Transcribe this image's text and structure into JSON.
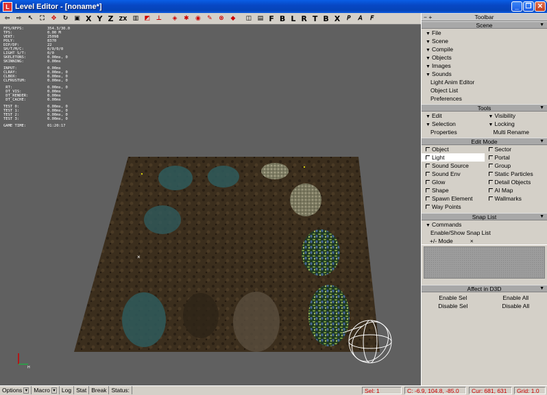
{
  "window": {
    "title": "Level Editor - [noname*]",
    "app_icon": "L"
  },
  "toolbar": {
    "axis_labels": [
      "X",
      "Y",
      "Z",
      "ZX"
    ],
    "view_labels": [
      "F",
      "B",
      "L",
      "R",
      "T",
      "B",
      "X"
    ],
    "icons": [
      "undo-icon",
      "redo-icon",
      "select-arrow-icon",
      "camera-icon",
      "move-icon",
      "rotate-icon",
      "scale-icon",
      "snap-grid-icon",
      "snap-object-icon",
      "snap-vertex-icon",
      "zoom-extents-icon",
      "render-icon",
      "delete-icon",
      "copy-icon",
      "paste-icon",
      "properties-icon",
      "new-icon",
      "open-icon",
      "perspective-icon",
      "orthographic-icon",
      "free-camera-icon"
    ]
  },
  "stats": [
    {
      "l": "FPS/RFPS:",
      "v": "354.3/30.0"
    },
    {
      "l": "TPS:",
      "v": "0.00 M"
    },
    {
      "l": "VERT:",
      "v": "25098"
    },
    {
      "l": "POLY:",
      "v": "8370"
    },
    {
      "l": "DIP/DP:",
      "v": "22"
    },
    {
      "l": "SH/T/M/C:",
      "v": "0/0/0/0"
    },
    {
      "l": "LIGHT S/T:",
      "v": "0/0"
    },
    {
      "l": "SKELETONS:",
      "v": "0.00ms, 0"
    },
    {
      "l": "SKINNING:",
      "v": "0.00ms"
    },
    {
      "gap": true
    },
    {
      "l": "INPUT:",
      "v": "0.00ms"
    },
    {
      "l": "CLRAY:",
      "v": "0.00ms, 0"
    },
    {
      "l": "CLBOX:",
      "v": "0.00ms, 0"
    },
    {
      "l": "CLFRUSTUM:",
      "v": "0.00ms, 0"
    },
    {
      "gap": true
    },
    {
      "l": " RT:",
      "v": "0.00ms, 0"
    },
    {
      "l": " DT_VIS:",
      "v": "0.00ms"
    },
    {
      "l": " DT_RENDER:",
      "v": "0.00ms"
    },
    {
      "l": " DT_CACHE:",
      "v": "0.00ms"
    },
    {
      "gap": true
    },
    {
      "l": "TEST 0:",
      "v": "0.00ms, 0"
    },
    {
      "l": "TEST 1:",
      "v": "0.00ms, 0"
    },
    {
      "l": "TEST 2:",
      "v": "0.00ms, 0"
    },
    {
      "l": "TEST 3:",
      "v": "0.00ms, 0"
    },
    {
      "gap": true
    },
    {
      "l": "GAME TIME:",
      "v": "01:20:17"
    }
  ],
  "sidebar": {
    "header": "Toolbar",
    "scene": {
      "title": "Scene",
      "items": [
        "File",
        "Scene",
        "Compile",
        "Objects",
        "Images",
        "Sounds"
      ],
      "links": [
        "Light Anim Editor",
        "Object List",
        "Preferences"
      ]
    },
    "tools": {
      "title": "Tools",
      "left": [
        "Edit",
        "Selection"
      ],
      "right": [
        "Visibility",
        "Locking"
      ],
      "left_link": "Properties",
      "right_link": "Multi Rename"
    },
    "edit_mode": {
      "title": "Edit Mode",
      "left": [
        "Object",
        "Light",
        "Sound Source",
        "Sound Env",
        "Glow",
        "Shape",
        "Spawn Element",
        "Way Points"
      ],
      "right": [
        "Sector",
        "Portal",
        "Group",
        "Static Particles",
        "Detail Objects",
        "AI Map",
        "Wallmarks"
      ],
      "selected": "Light"
    },
    "snap": {
      "title": "Snap List",
      "item": "Commands",
      "link": "Enable/Show Snap List",
      "tab_mode": "+/- Mode",
      "tab_x": "×"
    },
    "affect": {
      "title": "Affect in D3D",
      "enable_sel": "Enable Sel",
      "enable_all": "Enable All",
      "disable_sel": "Disable Sel",
      "disable_all": "Disable All"
    }
  },
  "statusbar": {
    "options": "Options",
    "macro": "Macro",
    "log": "Log",
    "stat": "Stat",
    "break": "Break",
    "status": "Status:",
    "sel": "Sel: 1",
    "coord": "C: -6.9, 104.8, -85.0",
    "cur": "Cur: 681, 631",
    "grid": "Grid: 1.0"
  },
  "gizmo": {
    "axis": "H"
  },
  "colors": {
    "floor": "#3b2e1d",
    "viewport": "#606060",
    "water": "#2f5a5c",
    "sidebar_header": "#a8a8a8"
  }
}
